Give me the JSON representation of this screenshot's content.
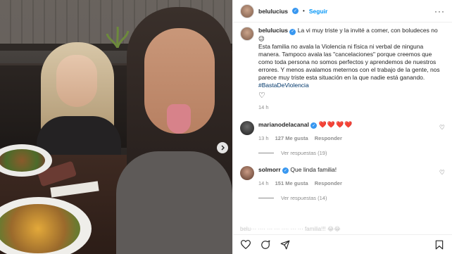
{
  "header": {
    "username": "belulucius",
    "separator": "•",
    "follow_label": "Seguir",
    "more_label": "···"
  },
  "caption": {
    "username": "belulucius",
    "first_line": "La vi muy triste y la invité a comer, con boludeces no",
    "emoji": "😉",
    "body": "Esta familia no avala la Violencia ni física ni verbal de ninguna manera. Tampoco avala las \"cancelaciones\" porque creemos que como toda persona no somos perfectos y aprendemos de nuestros errores. Y menos avalamos meternos con el trabajo de la gente, nos parece muy triste esta situación en la que nadie está ganando.",
    "hashtag": "#BastaDeViolencia",
    "heart": "♡",
    "time": "14 h"
  },
  "comments": [
    {
      "username": "marianodelacanal",
      "text": "❤️❤️❤️❤️",
      "time": "13 h",
      "likes": "127 Me gusta",
      "reply_label": "Responder",
      "view_replies": "Ver respuestas (19)",
      "avatar_color": "#3b3b3b"
    },
    {
      "username": "solmorr",
      "text": "Que linda familia!",
      "time": "14 h",
      "likes": "151 Me gusta",
      "reply_label": "Responder",
      "view_replies": "Ver respuestas (14)",
      "avatar_color": "#7a4a3a"
    }
  ],
  "partial_comment": "belu··· ···· ··· ··· ···· ··· ··· familia!!! 😂😂",
  "icons": {
    "like": "heart-icon",
    "comment": "comment-icon",
    "share": "share-icon",
    "save": "bookmark-icon",
    "next": "chevron-right-icon",
    "verified": "verified-badge-icon"
  },
  "colors": {
    "link_blue": "#0095f6",
    "verified_blue": "#3897f0",
    "heart_red": "#ed4956",
    "meta_gray": "#8e8e8e"
  }
}
